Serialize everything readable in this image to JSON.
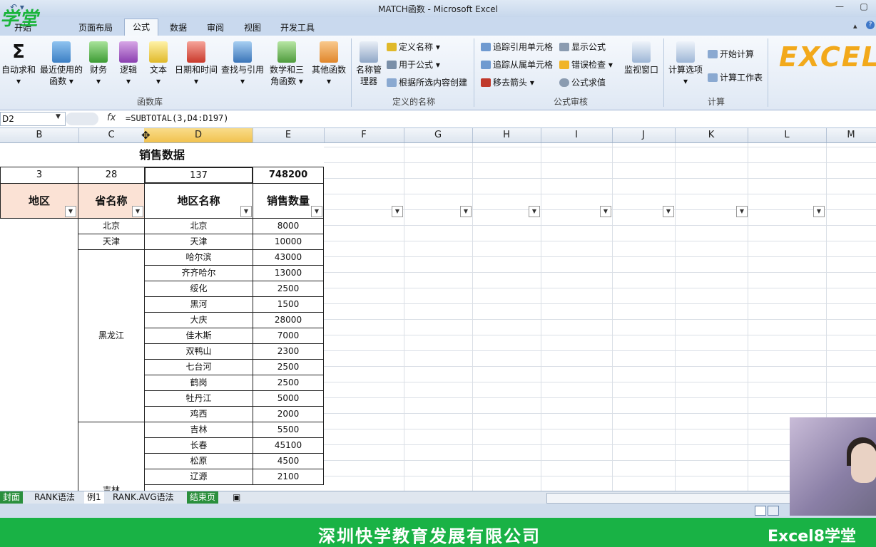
{
  "window": {
    "title": "MATCH函数 - Microsoft Excel",
    "help": "?"
  },
  "tabs": [
    {
      "label": "开始"
    },
    {
      "label": "页面布局"
    },
    {
      "label": "公式"
    },
    {
      "label": "数据"
    },
    {
      "label": "审阅"
    },
    {
      "label": "视图"
    },
    {
      "label": "开发工具"
    }
  ],
  "logo_text": "学堂",
  "ribbon": {
    "function_library": {
      "group_label": "函数库",
      "buttons": [
        "自动求和",
        "最近使用的函数",
        "财务",
        "逻辑",
        "文本",
        "日期和时间",
        "查找与引用",
        "数学和三角函数",
        "其他函数"
      ]
    },
    "defined_names": {
      "group_label": "定义的名称",
      "manager": "名称管理器",
      "items": [
        "定义名称",
        "用于公式",
        "根据所选内容创建"
      ]
    },
    "auditing": {
      "group_label": "公式审核",
      "items": [
        "追踪引用单元格",
        "追踪从属单元格",
        "移去箭头",
        "显示公式",
        "错误检查",
        "公式求值"
      ],
      "watch": "监视窗口"
    },
    "calculation": {
      "group_label": "计算",
      "options": "计算选项",
      "items": [
        "开始计算",
        "计算工作表"
      ]
    },
    "excel_logo": "EXCEL"
  },
  "formula_bar": {
    "name_box": "D2",
    "fx": "fx",
    "formula": "=SUBTOTAL(3,D4:D197)"
  },
  "columns": [
    "B",
    "C",
    "D",
    "E",
    "F",
    "G",
    "H",
    "I",
    "J",
    "K",
    "L",
    "M"
  ],
  "sheet": {
    "title": "销售数据",
    "row2": [
      "3",
      "28",
      "137",
      "748200"
    ],
    "headers": [
      "地区",
      "省名称",
      "地区名称",
      "销售数量"
    ],
    "province_groups": [
      "北京",
      "天津",
      "黑龙江",
      "吉林"
    ],
    "rows": [
      [
        "北京",
        "8000"
      ],
      [
        "天津",
        "10000"
      ],
      [
        "哈尔滨",
        "43000"
      ],
      [
        "齐齐哈尔",
        "13000"
      ],
      [
        "绥化",
        "2500"
      ],
      [
        "黑河",
        "1500"
      ],
      [
        "大庆",
        "28000"
      ],
      [
        "佳木斯",
        "7000"
      ],
      [
        "双鸭山",
        "2300"
      ],
      [
        "七台河",
        "2500"
      ],
      [
        "鹤岗",
        "2500"
      ],
      [
        "牡丹江",
        "5000"
      ],
      [
        "鸡西",
        "2000"
      ],
      [
        "吉林",
        "5500"
      ],
      [
        "长春",
        "45100"
      ],
      [
        "松原",
        "4500"
      ],
      [
        "辽源",
        "2100"
      ]
    ]
  },
  "sheet_tabs": [
    "封面",
    "RANK语法",
    "例1",
    "RANK.AVG语法",
    "结束页"
  ],
  "banner": {
    "company": "深圳快学教育发展有限公司",
    "brand": "Excel8学堂"
  }
}
